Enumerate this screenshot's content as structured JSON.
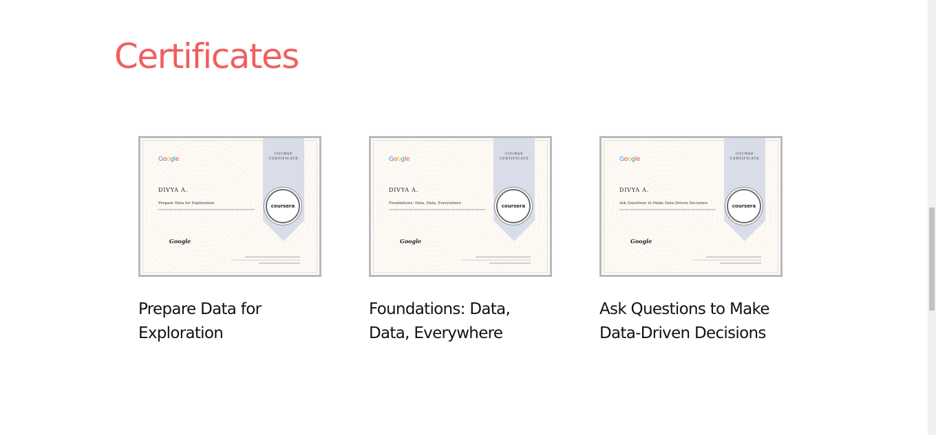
{
  "section": {
    "title": "Certificates",
    "title_color": "#ef5f5f"
  },
  "certificates": [
    {
      "title": "Prepare Data for Exploration",
      "image": {
        "issuer_logo": "Google",
        "ribbon_label": "COURSE\nCERTIFICATE",
        "seal_text": "coursera",
        "recipient": "DIVYA A.",
        "signature_logo": "Google"
      }
    },
    {
      "title": "Foundations: Data, Data, Everywhere",
      "image": {
        "issuer_logo": "Google",
        "ribbon_label": "COURSE\nCERTIFICATE",
        "seal_text": "coursera",
        "recipient": "DIVYA A.",
        "signature_logo": "Google"
      }
    },
    {
      "title": "Ask Questions to Make Data-Driven Decisions",
      "image": {
        "issuer_logo": "Google",
        "ribbon_label": "COURSE\nCERTIFICATE",
        "seal_text": "coursera",
        "recipient": "DIVYA A.",
        "signature_logo": "Google"
      }
    }
  ]
}
